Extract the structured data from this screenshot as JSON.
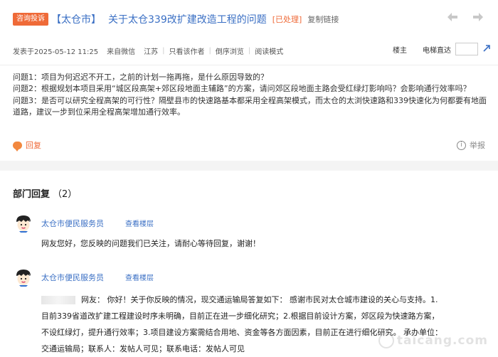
{
  "post": {
    "category": "咨询投诉",
    "title_prefix": "【太仓市】",
    "title": "关于太仓339改扩建改造工程的问题",
    "status": "[已处理]",
    "copy_link": "复制链接",
    "published": "发表于2025-05-12 11:25",
    "source": "来自微信",
    "region": "江苏",
    "only_author": "只看该作者",
    "reverse_browse": "倒序浏览",
    "reading_mode": "阅读模式",
    "floor": "楼主",
    "elevator": "电梯直达",
    "body": [
      "问题1：项目为何迟迟不开工，之前的计划一拖再拖，是什么原因导致的？",
      "问题2：根据规划本项目采用“城区段高架+郊区段地面主辅路”的方案，请问郊区段地面主路会受红绿灯影响吗？会影响通行效率吗？",
      "问题3：是否可以研究全程高架的可行性？隔壁县市的快速路基本都采用全程高架模式，而太仓的太浏快速路和339快速化为何都要有地面道路，建议一步到位采用全程高架增加通行效率。"
    ],
    "reply_label": "回复",
    "report_label": "举报"
  },
  "replies_section": {
    "title": "部门回复",
    "count": "（2）",
    "items": [
      {
        "author": "太仓市便民服务员",
        "view_floor": "查看楼层",
        "text": "网友您好，您反映的问题我们已关注，请耐心等待回复，谢谢！"
      },
      {
        "author": "太仓市便民服务员",
        "view_floor": "查看楼层",
        "line1": "网友：  你好！关于你反映的情况，现交通运输局答复如下：  感谢市民对太仓城市建设的关心与支持。1.",
        "line2": "目前339省道改扩建工程建设时序未明确，目前正在进一步细化研究；2.根据目前设计方案，郊区段为快速路方案，",
        "line3": "不设红绿灯，提升通行效率；3.项目建设方案需结合用地、资金等各方面因素，目前正在进行细化研究。  承办单位：",
        "line4": "交通运输局；联系人：发帖人可见；联系电话：发帖人可见"
      }
    ]
  },
  "watermark": "taicang.com",
  "icons": {
    "prev": "arrow-left-icon",
    "next": "arrow-right-icon",
    "jump": "jump-arrow-icon",
    "reply": "chat-bubble-icon",
    "report": "info-icon",
    "avatar": "cartoon-avatar-icon"
  },
  "colors": {
    "accent": "#ef6a38",
    "link": "#3a6fc4"
  }
}
